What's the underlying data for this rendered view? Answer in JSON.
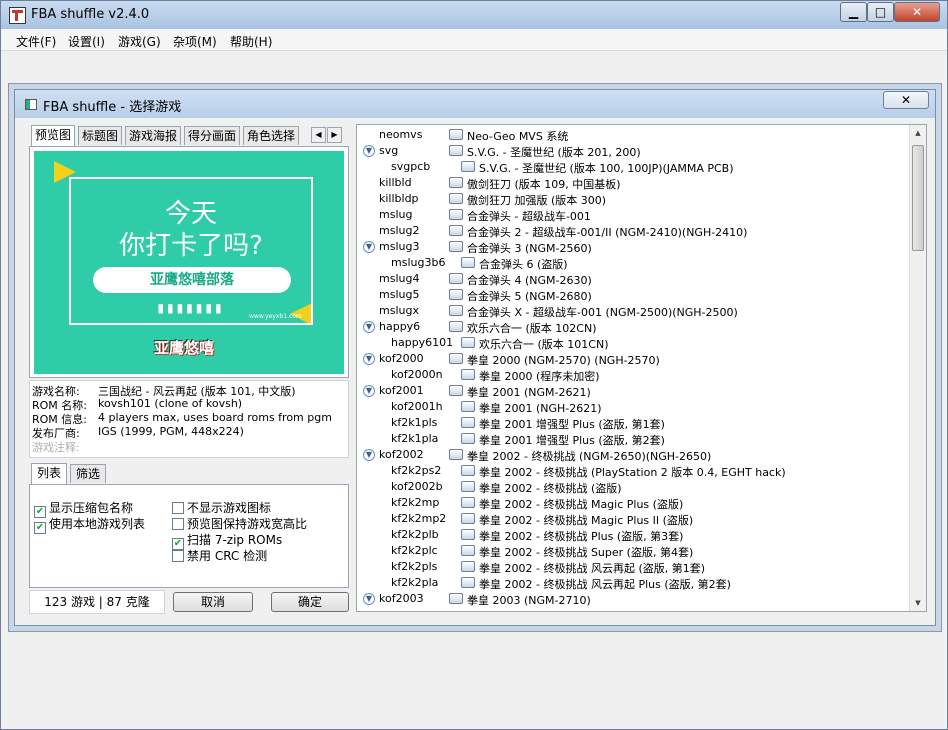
{
  "window": {
    "title": "FBA shuffle v2.4.0",
    "minimize": "▁",
    "maximize": "□",
    "close": "✕"
  },
  "menu": [
    "文件(F)",
    "设置(I)",
    "游戏(G)",
    "杂项(M)",
    "帮助(H)"
  ],
  "dialog": {
    "title": "FBA shuffle - 选择游戏",
    "close": "✕",
    "tabs": [
      "预览图",
      "标题图",
      "游戏海报",
      "得分画面",
      "角色选择"
    ],
    "tab_prev": "◀",
    "tab_next": "▶",
    "preview": {
      "line1": "今天",
      "line2": "你打卡了吗?",
      "pill": "亚鹰悠嘻部落",
      "dots": "▮▮▮▮▮▮▮",
      "url": "www.yeyxb1.com",
      "logo": "亚鹰悠嘻"
    },
    "info": [
      {
        "label": "游戏名称:",
        "value": "三国战纪 - 风云再起 (版本 101, 中文版)"
      },
      {
        "label": "ROM 名称:",
        "value": "kovsh101 (clone of kovsh)"
      },
      {
        "label": "ROM 信息:",
        "value": "4 players max, uses board roms from pgm"
      },
      {
        "label": "发布厂商:",
        "value": "IGS (1999, PGM, 448x224)"
      },
      {
        "label": "游戏注释:",
        "value": ""
      }
    ],
    "subtabs": [
      "列表",
      "筛选"
    ],
    "options": [
      {
        "label": "显示压缩包名称",
        "checked": true
      },
      {
        "label": "使用本地游戏列表",
        "checked": true
      },
      {
        "label": "不显示游戏图标",
        "checked": false
      },
      {
        "label": "预览图保持游戏宽高比",
        "checked": false
      },
      {
        "label": "扫描 7-zip ROMs",
        "checked": true
      },
      {
        "label": "禁用 CRC 检测",
        "checked": false
      }
    ],
    "check_mark": "✔",
    "status": "123 游戏 | 87 克隆",
    "cancel": "取消",
    "ok": "确定",
    "games": [
      {
        "rom": "neomvs",
        "name": "Neo-Geo MVS 系统",
        "level": 0,
        "expand": ""
      },
      {
        "rom": "svg",
        "name": "S.V.G. - 圣魔世纪 (版本 201, 200)",
        "level": 0,
        "expand": "▼"
      },
      {
        "rom": "svgpcb",
        "name": "S.V.G. - 圣魔世纪 (版本 100, 100JP)(JAMMA PCB)",
        "level": 1,
        "expand": ""
      },
      {
        "rom": "killbld",
        "name": "傲剑狂刀 (版本 109, 中国基板)",
        "level": 0,
        "expand": ""
      },
      {
        "rom": "killbldp",
        "name": "傲剑狂刀 加强版 (版本 300)",
        "level": 0,
        "expand": ""
      },
      {
        "rom": "mslug",
        "name": "合金弹头 - 超级战车-001",
        "level": 0,
        "expand": ""
      },
      {
        "rom": "mslug2",
        "name": "合金弹头 2 - 超级战车-001/II (NGM-2410)(NGH-2410)",
        "level": 0,
        "expand": ""
      },
      {
        "rom": "mslug3",
        "name": "合金弹头 3 (NGM-2560)",
        "level": 0,
        "expand": "▼"
      },
      {
        "rom": "mslug3b6",
        "name": "合金弹头 6 (盗版)",
        "level": 1,
        "expand": ""
      },
      {
        "rom": "mslug4",
        "name": "合金弹头 4 (NGM-2630)",
        "level": 0,
        "expand": ""
      },
      {
        "rom": "mslug5",
        "name": "合金弹头 5 (NGM-2680)",
        "level": 0,
        "expand": ""
      },
      {
        "rom": "mslugx",
        "name": "合金弹头 X - 超级战车-001 (NGM-2500)(NGH-2500)",
        "level": 0,
        "expand": ""
      },
      {
        "rom": "happy6",
        "name": "欢乐六合一 (版本 102CN)",
        "level": 0,
        "expand": "▼"
      },
      {
        "rom": "happy6101",
        "name": "欢乐六合一 (版本 101CN)",
        "level": 1,
        "expand": ""
      },
      {
        "rom": "kof2000",
        "name": "拳皇 2000 (NGM-2570) (NGH-2570)",
        "level": 0,
        "expand": "▼"
      },
      {
        "rom": "kof2000n",
        "name": "拳皇 2000 (程序未加密)",
        "level": 1,
        "expand": ""
      },
      {
        "rom": "kof2001",
        "name": "拳皇 2001 (NGM-2621)",
        "level": 0,
        "expand": "▼"
      },
      {
        "rom": "kof2001h",
        "name": "拳皇 2001 (NGH-2621)",
        "level": 1,
        "expand": ""
      },
      {
        "rom": "kf2k1pls",
        "name": "拳皇 2001 增强型 Plus (盗版, 第1套)",
        "level": 1,
        "expand": ""
      },
      {
        "rom": "kf2k1pla",
        "name": "拳皇 2001 增强型 Plus (盗版, 第2套)",
        "level": 1,
        "expand": ""
      },
      {
        "rom": "kof2002",
        "name": "拳皇 2002 - 终极挑战 (NGM-2650)(NGH-2650)",
        "level": 0,
        "expand": "▼"
      },
      {
        "rom": "kf2k2ps2",
        "name": "拳皇 2002 - 终极挑战 (PlayStation 2 版本 0.4, EGHT hack)",
        "level": 1,
        "expand": ""
      },
      {
        "rom": "kof2002b",
        "name": "拳皇 2002 - 终极挑战 (盗版)",
        "level": 1,
        "expand": ""
      },
      {
        "rom": "kf2k2mp",
        "name": "拳皇 2002 - 终极挑战 Magic Plus (盗版)",
        "level": 1,
        "expand": ""
      },
      {
        "rom": "kf2k2mp2",
        "name": "拳皇 2002 - 终极挑战 Magic Plus II (盗版)",
        "level": 1,
        "expand": ""
      },
      {
        "rom": "kf2k2plb",
        "name": "拳皇 2002 - 终极挑战 Plus (盗版, 第3套)",
        "level": 1,
        "expand": ""
      },
      {
        "rom": "kf2k2plc",
        "name": "拳皇 2002 - 终极挑战 Super (盗版, 第4套)",
        "level": 1,
        "expand": ""
      },
      {
        "rom": "kf2k2pls",
        "name": "拳皇 2002 - 终极挑战 风云再起 (盗版, 第1套)",
        "level": 1,
        "expand": ""
      },
      {
        "rom": "kf2k2pla",
        "name": "拳皇 2002 - 终极挑战 风云再起 Plus (盗版, 第2套)",
        "level": 1,
        "expand": ""
      },
      {
        "rom": "kof2003",
        "name": "拳皇 2003 (NGM-2710)",
        "level": 0,
        "expand": "▼"
      }
    ],
    "scroll_up": "▲",
    "scroll_down": "▼"
  }
}
